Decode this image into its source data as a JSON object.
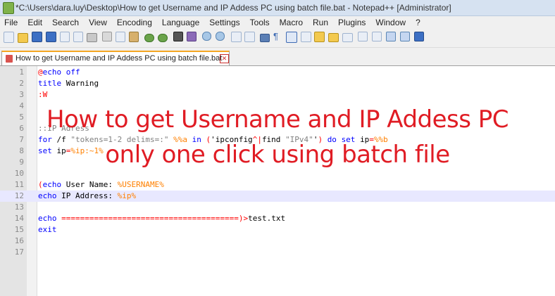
{
  "window": {
    "title": "*C:\\Users\\dara.luy\\Desktop\\How to get Username and IP Addess PC using batch file.bat - Notepad++ [Administrator]"
  },
  "menu": [
    "File",
    "Edit",
    "Search",
    "View",
    "Encoding",
    "Language",
    "Settings",
    "Tools",
    "Macro",
    "Run",
    "Plugins",
    "Window",
    "?"
  ],
  "toolbar": {
    "icons": [
      "new-file-icon",
      "open-file-icon",
      "save-icon",
      "save-all-icon",
      "close-icon",
      "close-all-icon",
      "print-icon",
      "cut-icon",
      "copy-icon",
      "paste-icon",
      "undo-icon",
      "redo-icon",
      "find-icon",
      "replace-icon",
      "zoom-in-icon",
      "zoom-out-icon",
      "sync-v-icon",
      "sync-h-icon",
      "word-wrap-icon",
      "show-all-chars-icon",
      "indent-guide-icon",
      "doc-map-icon",
      "function-list-icon",
      "folder-workspace-icon",
      "monitor-icon",
      "record-macro-icon",
      "stop-macro-icon",
      "play-macro-icon",
      "run-macro-multiple-icon",
      "save-macro-icon"
    ]
  },
  "tab": {
    "label": "How to get Username and IP Addess PC using batch file.bat"
  },
  "editor": {
    "current_line": 12,
    "lines": [
      {
        "n": "1",
        "code": "@echo off"
      },
      {
        "n": "2",
        "code": "title Warning"
      },
      {
        "n": "3",
        "code": ":W"
      },
      {
        "n": "4",
        "code": ""
      },
      {
        "n": "5",
        "code": ""
      },
      {
        "n": "6",
        "code": "::IP Adress"
      },
      {
        "n": "7",
        "code": "for /f \"tokens=1-2 delims=:\" %%a in ('ipconfig^|find \"IPv4\"') do set ip=%%b"
      },
      {
        "n": "8",
        "code": "set ip=%ip:~1%"
      },
      {
        "n": "9",
        "code": ""
      },
      {
        "n": "10",
        "code": ""
      },
      {
        "n": "11",
        "code": "(echo User Name: %USERNAME%"
      },
      {
        "n": "12",
        "code": "echo IP Address: %ip%"
      },
      {
        "n": "13",
        "code": ""
      },
      {
        "n": "14",
        "code": "echo ======================================)>test.txt"
      },
      {
        "n": "15",
        "code": "exit"
      },
      {
        "n": "16",
        "code": ""
      },
      {
        "n": "17",
        "code": ""
      }
    ]
  },
  "overlay": {
    "line1": "How to get Username and IP Addess PC",
    "line2": "only one click using batch file",
    "color": "#e01c24"
  }
}
